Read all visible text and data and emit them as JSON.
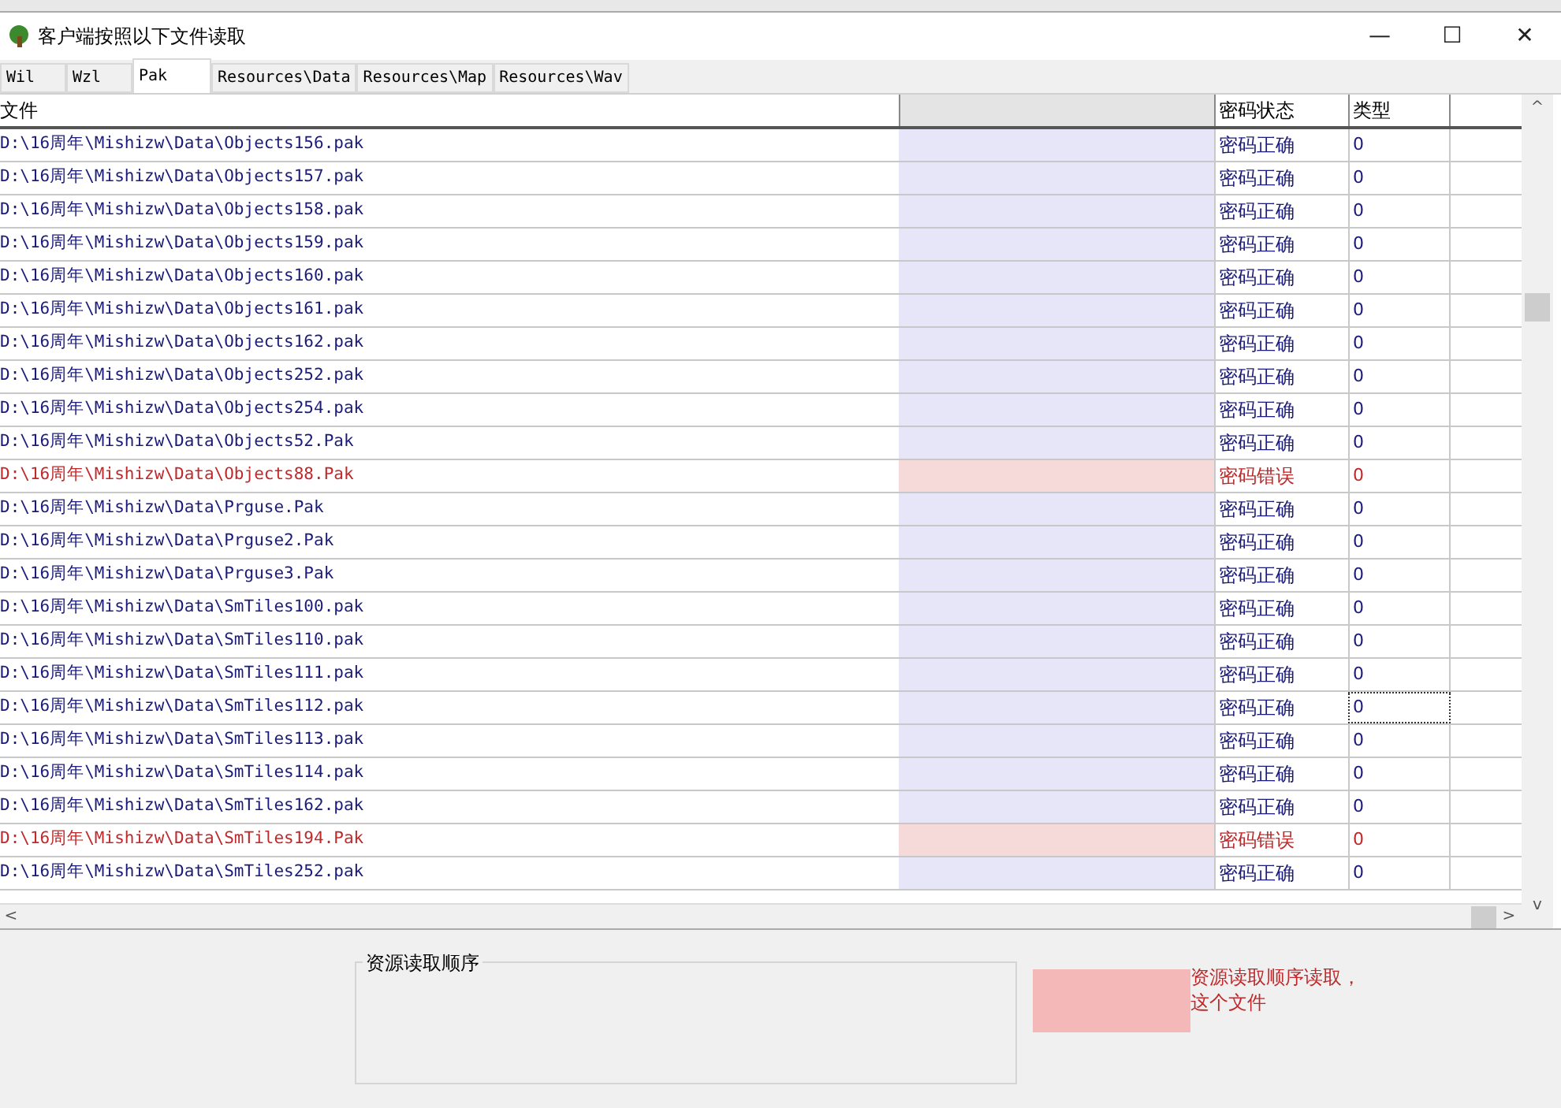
{
  "window": {
    "title": "客户端按照以下文件读取",
    "controls": [
      "—",
      "☐",
      "✕"
    ]
  },
  "tabs": [
    {
      "label": "Wil",
      "selected": false
    },
    {
      "label": "Wzl",
      "selected": false
    },
    {
      "label": "Pak",
      "selected": true
    },
    {
      "label": "Resources\\Data",
      "selected": false
    },
    {
      "label": "Resources\\Map",
      "selected": false
    },
    {
      "label": "Resources\\Wav",
      "selected": false
    }
  ],
  "table": {
    "columns": [
      "文件",
      "密码状态",
      "类型"
    ],
    "rows": [
      {
        "file": "D:\\16周年\\Mishizw\\Data\\Objects156.pak",
        "kind": "ok",
        "status": "密码正确",
        "type": "0",
        "selected": false
      },
      {
        "file": "D:\\16周年\\Mishizw\\Data\\Objects157.pak",
        "kind": "ok",
        "status": "密码正确",
        "type": "0",
        "selected": false
      },
      {
        "file": "D:\\16周年\\Mishizw\\Data\\Objects158.pak",
        "kind": "ok",
        "status": "密码正确",
        "type": "0",
        "selected": false
      },
      {
        "file": "D:\\16周年\\Mishizw\\Data\\Objects159.pak",
        "kind": "ok",
        "status": "密码正确",
        "type": "0",
        "selected": false
      },
      {
        "file": "D:\\16周年\\Mishizw\\Data\\Objects160.pak",
        "kind": "ok",
        "status": "密码正确",
        "type": "0",
        "selected": false
      },
      {
        "file": "D:\\16周年\\Mishizw\\Data\\Objects161.pak",
        "kind": "ok",
        "status": "密码正确",
        "type": "0",
        "selected": false
      },
      {
        "file": "D:\\16周年\\Mishizw\\Data\\Objects162.pak",
        "kind": "ok",
        "status": "密码正确",
        "type": "0",
        "selected": false
      },
      {
        "file": "D:\\16周年\\Mishizw\\Data\\Objects252.pak",
        "kind": "ok",
        "status": "密码正确",
        "type": "0",
        "selected": false
      },
      {
        "file": "D:\\16周年\\Mishizw\\Data\\Objects254.pak",
        "kind": "ok",
        "status": "密码正确",
        "type": "0",
        "selected": false
      },
      {
        "file": "D:\\16周年\\Mishizw\\Data\\Objects52.Pak",
        "kind": "ok",
        "status": "密码正确",
        "type": "0",
        "selected": false
      },
      {
        "file": "D:\\16周年\\Mishizw\\Data\\Objects88.Pak",
        "kind": "error",
        "status": "密码错误",
        "type": "0",
        "selected": false
      },
      {
        "file": "D:\\16周年\\Mishizw\\Data\\Prguse.Pak",
        "kind": "ok",
        "status": "密码正确",
        "type": "0",
        "selected": false
      },
      {
        "file": "D:\\16周年\\Mishizw\\Data\\Prguse2.Pak",
        "kind": "ok",
        "status": "密码正确",
        "type": "0",
        "selected": false
      },
      {
        "file": "D:\\16周年\\Mishizw\\Data\\Prguse3.Pak",
        "kind": "ok",
        "status": "密码正确",
        "type": "0",
        "selected": false
      },
      {
        "file": "D:\\16周年\\Mishizw\\Data\\SmTiles100.pak",
        "kind": "ok",
        "status": "密码正确",
        "type": "0",
        "selected": false
      },
      {
        "file": "D:\\16周年\\Mishizw\\Data\\SmTiles110.pak",
        "kind": "ok",
        "status": "密码正确",
        "type": "0",
        "selected": false
      },
      {
        "file": "D:\\16周年\\Mishizw\\Data\\SmTiles111.pak",
        "kind": "ok",
        "status": "密码正确",
        "type": "0",
        "selected": false
      },
      {
        "file": "D:\\16周年\\Mishizw\\Data\\SmTiles112.pak",
        "kind": "ok",
        "status": "密码正确",
        "type": "0",
        "selected": true
      },
      {
        "file": "D:\\16周年\\Mishizw\\Data\\SmTiles113.pak",
        "kind": "ok",
        "status": "密码正确",
        "type": "0",
        "selected": false
      },
      {
        "file": "D:\\16周年\\Mishizw\\Data\\SmTiles114.pak",
        "kind": "ok",
        "status": "密码正确",
        "type": "0",
        "selected": false
      },
      {
        "file": "D:\\16周年\\Mishizw\\Data\\SmTiles162.pak",
        "kind": "ok",
        "status": "密码正确",
        "type": "0",
        "selected": false
      },
      {
        "file": "D:\\16周年\\Mishizw\\Data\\SmTiles194.Pak",
        "kind": "error",
        "status": "密码错误",
        "type": "0",
        "selected": false
      },
      {
        "file": "D:\\16周年\\Mishizw\\Data\\SmTiles252.pak",
        "kind": "ok",
        "status": "密码正确",
        "type": "0",
        "selected": false
      }
    ]
  },
  "scroll_buttons": [
    "^",
    "v",
    "<",
    ">"
  ],
  "group": {
    "title": "资源读取顺序"
  },
  "notes": [
    "资源读取顺序读取，",
    "这个文件"
  ]
}
